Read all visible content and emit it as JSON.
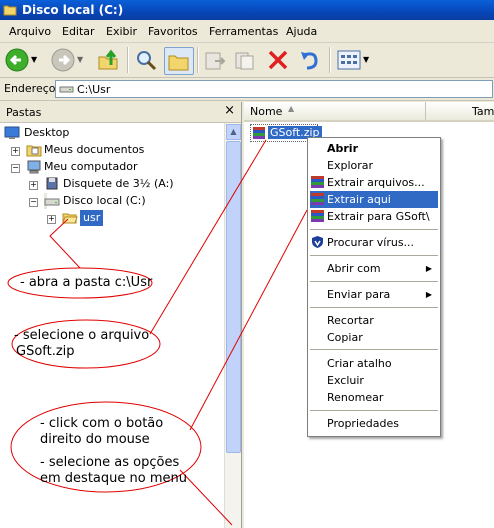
{
  "window": {
    "title": "Disco local (C:)"
  },
  "menubar": [
    "Arquivo",
    "Editar",
    "Exibir",
    "Favoritos",
    "Ferramentas",
    "Ajuda"
  ],
  "address": {
    "label": "Endereço",
    "value": "C:\\Usr"
  },
  "folders_pane": {
    "title": "Pastas",
    "close": "×",
    "tree": [
      "Desktop",
      "Meus documentos",
      "Meu computador",
      "Disquete de 3½ (A:)",
      "Disco local (C:)",
      "usr"
    ]
  },
  "file_list": {
    "columns": [
      "Nome",
      "Tama"
    ],
    "files": [
      "GSoft.zip"
    ]
  },
  "context_menu": {
    "items": [
      "Abrir",
      "Explorar",
      "Extrair arquivos...",
      "Extrair aqui",
      "Extrair para GSoft\\",
      "Procurar vírus...",
      "Abrir com",
      "Enviar para",
      "Recortar",
      "Copiar",
      "Criar atalho",
      "Excluir",
      "Renomear",
      "Propriedades"
    ],
    "highlighted": "Extrair aqui"
  },
  "annotations": {
    "step1": "- abra a pasta c:\\Usr",
    "step2a": "- selecione o arquivo",
    "step2b": "GSoft.zip",
    "step3a": "- click com o botão",
    "step3b": "direito do mouse",
    "step4a": "- selecione as opções",
    "step4b": "em destaque no menu"
  },
  "colors": {
    "highlight": "#316ac5",
    "annotation_line": "#e00000",
    "titlebar": "#0a5fd8"
  }
}
